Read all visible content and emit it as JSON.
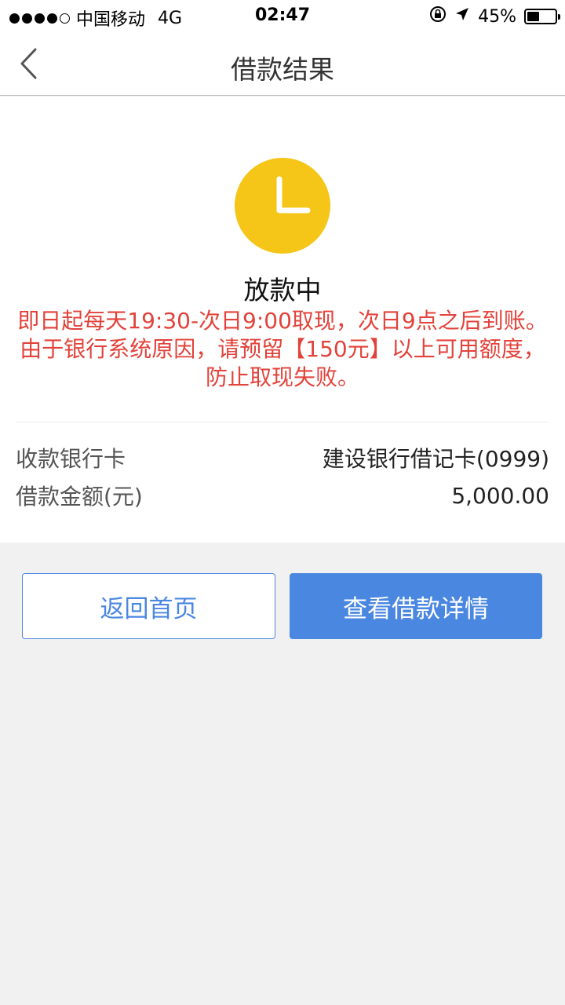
{
  "status_bar": {
    "carrier": "中国移动",
    "network": "4G",
    "time": "02:47",
    "battery": "45%",
    "battery_level": 0.45,
    "signal_bars_filled": 4,
    "signal_bars_total": 5
  },
  "nav": {
    "title": "借款结果"
  },
  "result": {
    "status": "放款中",
    "notice": "即日起每天19:30-次日9:00取现，次日9点之后到账。由于银行系统原因，请预留【150元】以上可用额度，防止取现失败。"
  },
  "info": {
    "bank_label": "收款银行卡",
    "bank_value": "建设银行借记卡(0999)",
    "amount_label": "借款金额(元)",
    "amount_value": "5,000.00"
  },
  "buttons": {
    "home": "返回首页",
    "detail": "查看借款详情"
  },
  "colors": {
    "accent": "#4a87e0",
    "notice": "#e2423a",
    "clock": "#f5c518"
  }
}
